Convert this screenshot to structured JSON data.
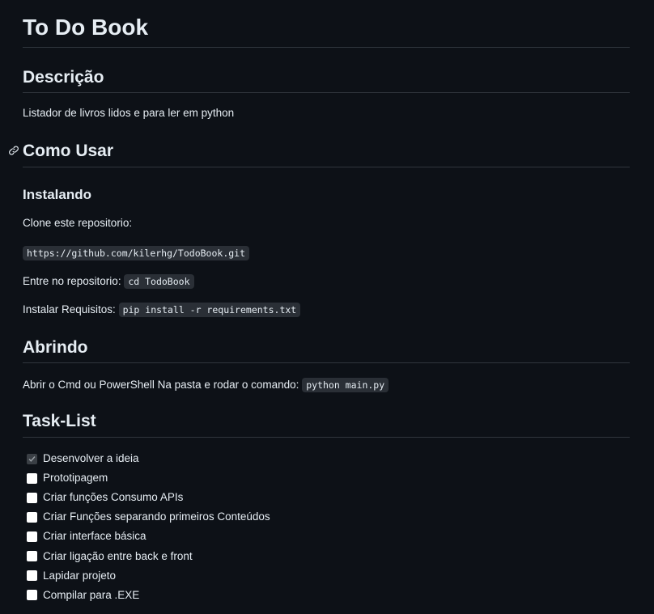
{
  "title": "To Do Book",
  "sections": {
    "descricao": {
      "heading": "Descrição",
      "text": "Listador de livros lidos e para ler em python"
    },
    "como_usar": {
      "heading": "Como Usar",
      "anchor_icon": "link-icon"
    },
    "instalando": {
      "heading": "Instalando",
      "clone_text": "Clone este repositorio:",
      "clone_code": "https://github.com/kilerhg/TodoBook.git",
      "enter_text": "Entre no repositorio:",
      "enter_code": "cd TodoBook",
      "req_text": "Instalar Requisitos:",
      "req_code": "pip install -r requirements.txt"
    },
    "abrindo": {
      "heading": "Abrindo",
      "text": "Abrir o Cmd ou PowerShell Na pasta e rodar o comando:",
      "code": "python main.py"
    },
    "tasklist": {
      "heading": "Task-List",
      "items": [
        {
          "label": "Desenvolver a ideia",
          "checked": true
        },
        {
          "label": "Prototipagem",
          "checked": false
        },
        {
          "label": "Criar funções Consumo APIs",
          "checked": false
        },
        {
          "label": "Criar Funções separando primeiros Conteúdos",
          "checked": false
        },
        {
          "label": "Criar interface básica",
          "checked": false
        },
        {
          "label": "Criar ligação entre back e front",
          "checked": false
        },
        {
          "label": "Lapidar projeto",
          "checked": false
        },
        {
          "label": "Compilar para .EXE",
          "checked": false
        }
      ]
    }
  },
  "colors": {
    "background": "#0d1117",
    "text": "#e6edf3",
    "rule": "#30363d",
    "code_bg": "#2a2f36"
  }
}
